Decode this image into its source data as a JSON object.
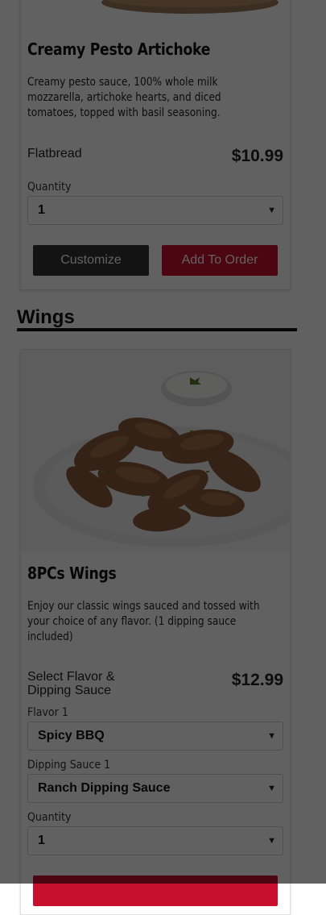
{
  "items": [
    {
      "title": "Creamy Pesto Artichoke",
      "description": "Creamy pesto sauce, 100% whole milk mozzarella, artichoke hearts, and diced tomatoes, topped with basil seasoning.",
      "size_label": "Flatbread",
      "price": "$10.99",
      "quantity_label": "Quantity",
      "quantity_value": "1",
      "customize_label": "Customize",
      "add_label": "Add To Order"
    },
    {
      "title": "8PCs Wings",
      "description": "Enjoy our classic wings sauced and tossed with your choice of any flavor. (1 dipping sauce included)",
      "size_label": "Select Flavor & Dipping Sauce",
      "price": "$12.99",
      "flavor_label": "Flavor 1",
      "flavor_value": "Spicy BBQ",
      "sauce_label": "Dipping Sauce 1",
      "sauce_value": "Ranch Dipping Sauce",
      "quantity_label": "Quantity",
      "quantity_value": "1"
    }
  ],
  "section": {
    "title": "Wings"
  },
  "icons": {
    "dropdown": "chevron-down-icon"
  },
  "colors": {
    "customize_bg": "#333333",
    "add_bg": "#c8102e",
    "overlay": "rgba(0,0,0,0.62)"
  }
}
